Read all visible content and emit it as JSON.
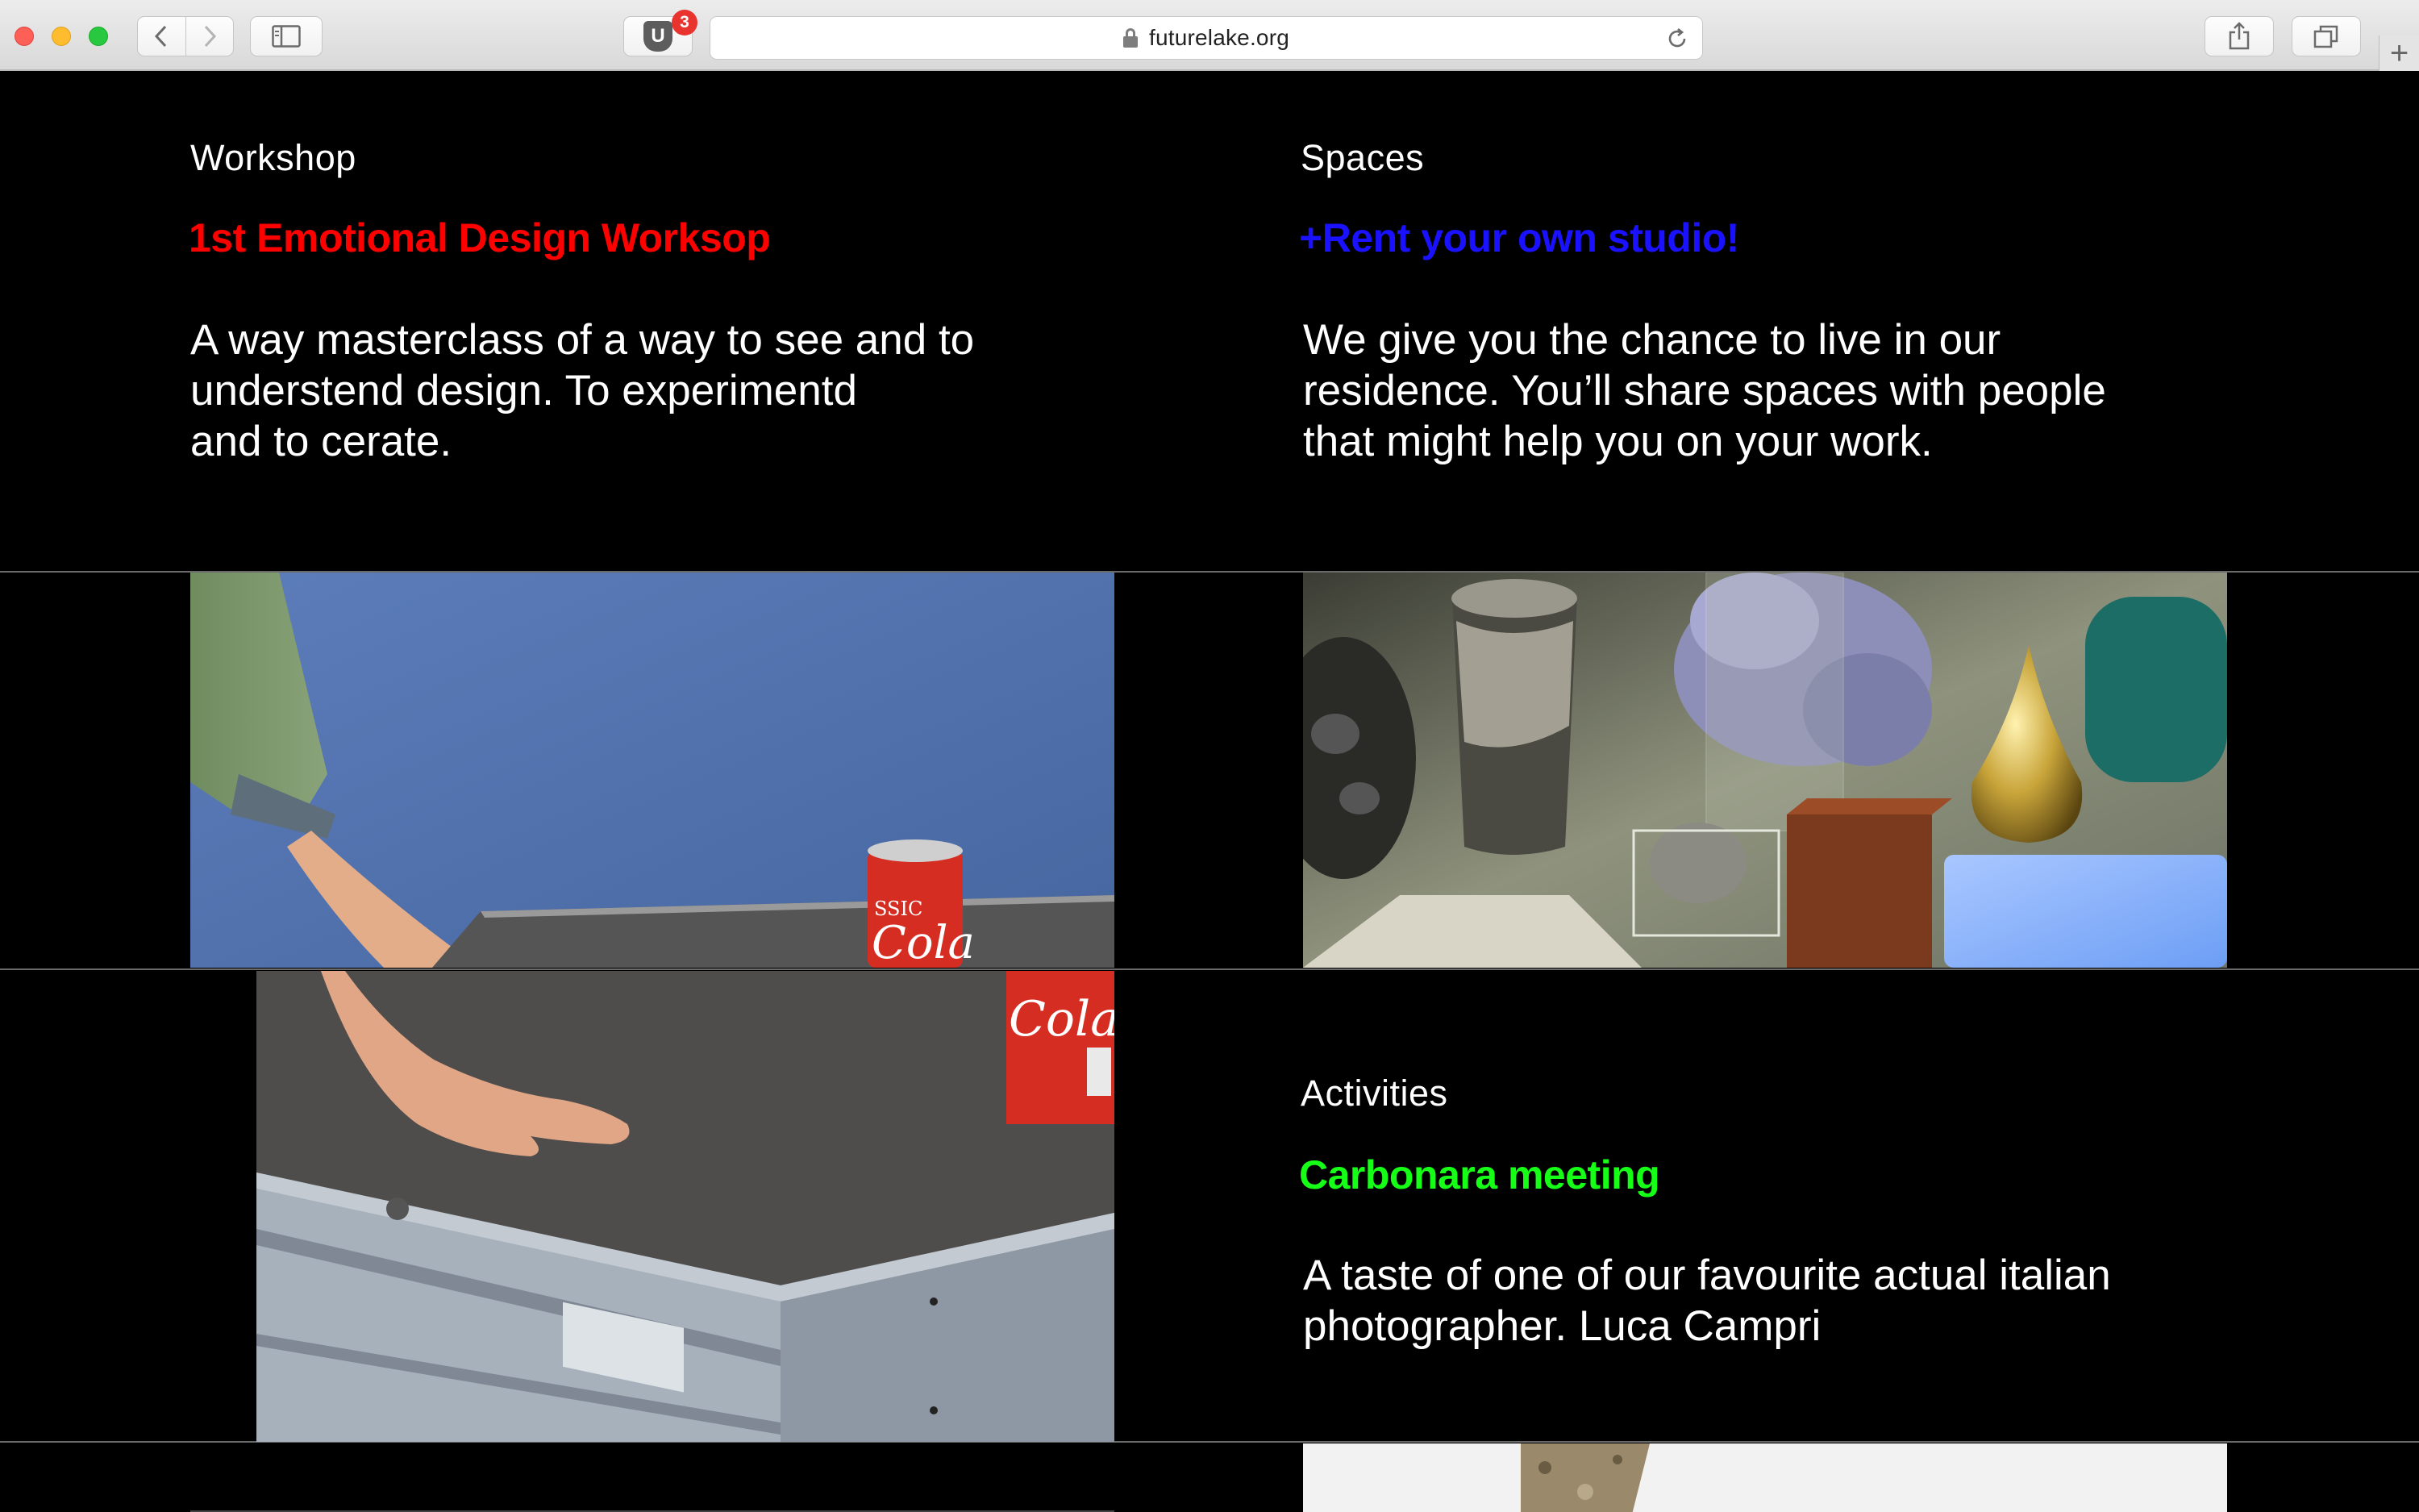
{
  "browser": {
    "url": "futurelake.org",
    "extension_badge": "3",
    "extension_letter": "U",
    "newtab_label": "+",
    "icons": [
      "back-icon",
      "forward-icon",
      "sidebar-icon",
      "lock-icon",
      "reload-icon",
      "share-icon",
      "tabs-icon"
    ]
  },
  "sections": {
    "workshop": {
      "category": "Workshop",
      "title": "1st Emotional Design Worksop",
      "title_color": "#ff0000",
      "description_lines": [
        "A way masterclass of a way to see and to",
        "understend design. To experimentd",
        "and to cerate."
      ]
    },
    "spaces": {
      "category": "Spaces",
      "title": "+Rent your own studio!",
      "title_color": "#1a12ff",
      "description_lines": [
        "We give you the chance to live in our",
        "residence. You’ll share spaces with people",
        "that might help you on your work."
      ]
    },
    "activities": {
      "category": "Activities",
      "title": "Carbonara meeting",
      "title_color": "#16ff16",
      "description_lines": [
        "A taste of  one of our favourite actual italian",
        "photographer. Luca Campri"
      ]
    }
  },
  "images": {
    "workshop_can_text_top": "SSIC",
    "workshop_can_text": "Cola"
  }
}
